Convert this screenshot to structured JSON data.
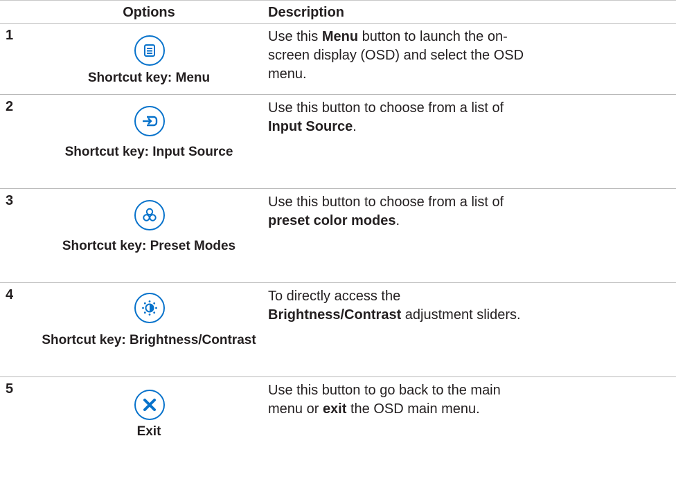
{
  "header": {
    "options": "Options",
    "description": "Description"
  },
  "rows": [
    {
      "number": "1",
      "icon": "menu-icon",
      "shortcut": "Shortcut key:  Menu",
      "desc_before": "Use this ",
      "desc_bold": "Menu",
      "desc_after": " button to launch the on-screen display (OSD) and select the OSD menu."
    },
    {
      "number": "2",
      "icon": "input-source-icon",
      "shortcut": "Shortcut key: Input Source",
      "desc_before": "Use this button to choose from a list of ",
      "desc_bold": "Input Source",
      "desc_after": "."
    },
    {
      "number": "3",
      "icon": "preset-modes-icon",
      "shortcut": "Shortcut key: Preset Modes",
      "desc_before": "Use this button to choose from a list of ",
      "desc_bold": "preset color modes",
      "desc_after": "."
    },
    {
      "number": "4",
      "icon": "brightness-contrast-icon",
      "shortcut": "Shortcut key: Brightness/Contrast",
      "desc_before": "To directly access the ",
      "desc_bold": "Brightness/Contrast",
      "desc_after": " adjustment sliders."
    },
    {
      "number": "5",
      "icon": "exit-icon",
      "shortcut": "Exit",
      "desc_before": "Use this button to go back to the main menu or ",
      "desc_bold": "exit",
      "desc_after": " the OSD main menu."
    }
  ],
  "colors": {
    "accent": "#0672cb",
    "text": "#231f20",
    "rule": "#b9b9b9"
  }
}
